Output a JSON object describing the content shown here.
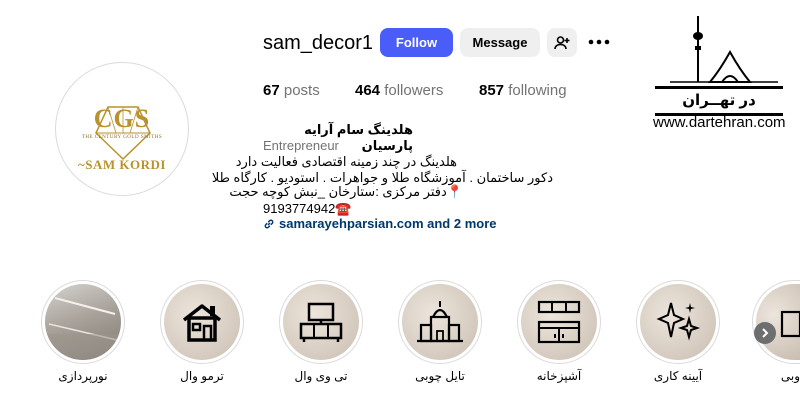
{
  "profile": {
    "username": "sam_decor1",
    "avatar_logo": {
      "monogram": "CGS",
      "subtitle": "THE CENTURY GOLD SMITHS",
      "name": "~SAM KORDI"
    }
  },
  "actions": {
    "follow_label": "Follow",
    "message_label": "Message",
    "suggest_icon": "person-add-icon",
    "more_icon": "ellipsis-icon"
  },
  "stats": {
    "posts": {
      "count": "67",
      "label": "posts"
    },
    "followers": {
      "count": "464",
      "label": "followers"
    },
    "following": {
      "count": "857",
      "label": "following"
    }
  },
  "bio": {
    "name": "هلدینگ سام آرایه پارسیان",
    "category": "Entrepreneur",
    "line1": "هلدینگ در چند زمینه اقتصادی فعالیت دارد",
    "line2": "دکور ساختمان . آموزشگاه طلا و جواهرات . استودیو . کارگاه طلا",
    "line3": "📍دفتر مرکزی :ستارخان _نبش کوچه حجت",
    "phone": "9193774942☎️",
    "link": "samarayehparsian.com and 2 more"
  },
  "watermark": {
    "title": "در تهــران",
    "url": "www.dartehran.com"
  },
  "highlights": [
    {
      "label": "نورپردازی",
      "icon": "ceiling-lighting-photo"
    },
    {
      "label": "ترمو وال",
      "icon": "house-icon"
    },
    {
      "label": "تی وی وال",
      "icon": "tv-stand-icon"
    },
    {
      "label": "تایل چوبی",
      "icon": "building-icon"
    },
    {
      "label": "آشپزخانه",
      "icon": "kitchen-cabinet-icon"
    },
    {
      "label": "آیینه کاری",
      "icon": "sparkle-icon"
    },
    {
      "label": "وبی",
      "icon": "partial-highlight"
    }
  ],
  "colors": {
    "follow_button": "#4a5df9",
    "link": "#00376b",
    "secondary_button": "#efefef"
  }
}
